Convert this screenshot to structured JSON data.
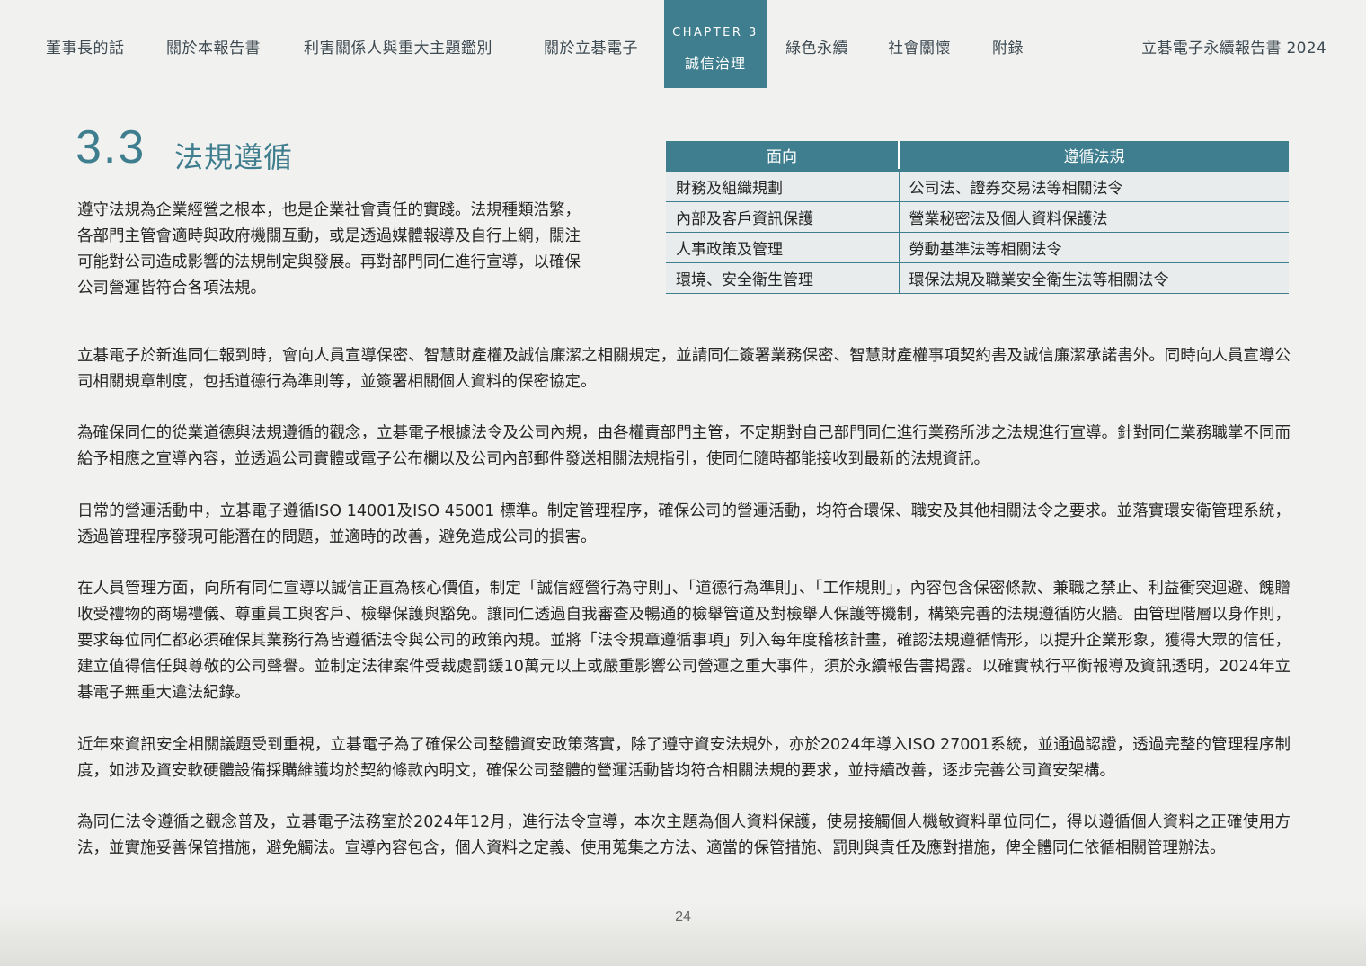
{
  "nav": {
    "items": [
      "董事長的話",
      "關於本報告書",
      "利害關係人與重大主題鑑別",
      "關於立碁電子",
      "綠色永續",
      "社會關懷",
      "附錄"
    ],
    "chapter_label": "CHAPTER 3",
    "chapter_title": "誠信治理",
    "report_title": "立碁電子永續報告書 2024",
    "accent_color": "#3f7e8e"
  },
  "section": {
    "number": "3.3",
    "title": "法規遵循",
    "intro": "遵守法規為企業經營之根本，也是企業社會責任的實踐。法規種類浩繁，各部門主管會適時與政府機關互動，或是透過媒體報導及自行上網，關注可能對公司造成影響的法規制定與發展。再對部門同仁進行宣導，以確保公司營運皆符合各項法規。"
  },
  "table": {
    "headers": [
      "面向",
      "遵循法規"
    ],
    "rows": [
      [
        "財務及組織規劃",
        "公司法、證券交易法等相關法令"
      ],
      [
        "內部及客戶資訊保護",
        "營業秘密法及個人資料保護法"
      ],
      [
        "人事政策及管理",
        "勞動基準法等相關法令"
      ],
      [
        "環境、安全衛生管理",
        "環保法規及職業安全衛生法等相關法令"
      ]
    ]
  },
  "paragraphs": [
    "立碁電子於新進同仁報到時，會向人員宣導保密、智慧財產權及誠信廉潔之相關規定，並請同仁簽署業務保密、智慧財產權事項契約書及誠信廉潔承諾書外。同時向人員宣導公司相關規章制度，包括道德行為準則等，並簽署相關個人資料的保密協定。",
    "為確保同仁的從業道德與法規遵循的觀念，立碁電子根據法令及公司內規，由各權責部門主管，不定期對自己部門同仁進行業務所涉之法規進行宣導。針對同仁業務職掌不同而給予相應之宣導內容，並透過公司實體或電子公布欄以及公司內部郵件發送相關法規指引，使同仁隨時都能接收到最新的法規資訊。",
    "日常的營運活動中，立碁電子遵循ISO 14001及ISO 45001 標準。制定管理程序，確保公司的營運活動，均符合環保、職安及其他相關法令之要求。並落實環安衛管理系統，透過管理程序發現可能潛在的問題，並適時的改善，避免造成公司的損害。",
    "在人員管理方面，向所有同仁宣導以誠信正直為核心價值，制定「誠信經營行為守則」、「道德行為準則」、「工作規則」，內容包含保密條款、兼職之禁止、利益衝突迴避、餽贈收受禮物的商場禮儀、尊重員工與客戶、檢舉保護與豁免。讓同仁透過自我審查及暢通的檢舉管道及對檢舉人保護等機制，構築完善的法規遵循防火牆。由管理階層以身作則，要求每位同仁都必須確保其業務行為皆遵循法令與公司的政策內規。並將「法令規章遵循事項」列入每年度稽核計畫，確認法規遵循情形，以提升企業形象，獲得大眾的信任，建立值得信任與尊敬的公司聲譽。並制定法律案件受裁處罰鍰10萬元以上或嚴重影響公司營運之重大事件，須於永續報告書揭露。以確實執行平衡報導及資訊透明，2024年立碁電子無重大違法紀錄。",
    "近年來資訊安全相關議題受到重視，立碁電子為了確保公司整體資安政策落實，除了遵守資安法規外，亦於2024年導入ISO 27001系統，並通過認證，透過完整的管理程序制度，如涉及資安軟硬體設備採購維護均於契約條款內明文，確保公司整體的營運活動皆均符合相關法規的要求，並持續改善，逐步完善公司資安架構。",
    "為同仁法令遵循之觀念普及，立碁電子法務室於2024年12月，進行法令宣導，本次主題為個人資料保護，使易接觸個人機敏資料單位同仁，得以遵循個人資料之正確使用方法，並實施妥善保管措施，避免觸法。宣導內容包含，個人資料之定義、使用蒐集之方法、適當的保管措施、罰則與責任及應對措施，俾全體同仁依循相關管理辦法。"
  ],
  "page_number": "24"
}
